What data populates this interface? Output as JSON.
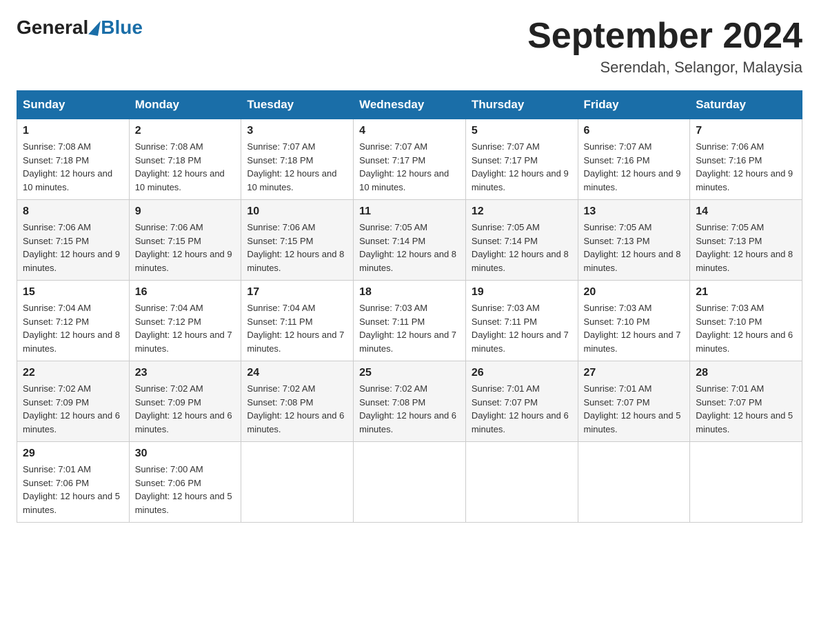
{
  "header": {
    "logo_general": "General",
    "logo_blue": "Blue",
    "month_title": "September 2024",
    "location": "Serendah, Selangor, Malaysia"
  },
  "weekdays": [
    "Sunday",
    "Monday",
    "Tuesday",
    "Wednesday",
    "Thursday",
    "Friday",
    "Saturday"
  ],
  "weeks": [
    [
      {
        "day": "1",
        "sunrise": "7:08 AM",
        "sunset": "7:18 PM",
        "daylight": "12 hours and 10 minutes."
      },
      {
        "day": "2",
        "sunrise": "7:08 AM",
        "sunset": "7:18 PM",
        "daylight": "12 hours and 10 minutes."
      },
      {
        "day": "3",
        "sunrise": "7:07 AM",
        "sunset": "7:18 PM",
        "daylight": "12 hours and 10 minutes."
      },
      {
        "day": "4",
        "sunrise": "7:07 AM",
        "sunset": "7:17 PM",
        "daylight": "12 hours and 10 minutes."
      },
      {
        "day": "5",
        "sunrise": "7:07 AM",
        "sunset": "7:17 PM",
        "daylight": "12 hours and 9 minutes."
      },
      {
        "day": "6",
        "sunrise": "7:07 AM",
        "sunset": "7:16 PM",
        "daylight": "12 hours and 9 minutes."
      },
      {
        "day": "7",
        "sunrise": "7:06 AM",
        "sunset": "7:16 PM",
        "daylight": "12 hours and 9 minutes."
      }
    ],
    [
      {
        "day": "8",
        "sunrise": "7:06 AM",
        "sunset": "7:15 PM",
        "daylight": "12 hours and 9 minutes."
      },
      {
        "day": "9",
        "sunrise": "7:06 AM",
        "sunset": "7:15 PM",
        "daylight": "12 hours and 9 minutes."
      },
      {
        "day": "10",
        "sunrise": "7:06 AM",
        "sunset": "7:15 PM",
        "daylight": "12 hours and 8 minutes."
      },
      {
        "day": "11",
        "sunrise": "7:05 AM",
        "sunset": "7:14 PM",
        "daylight": "12 hours and 8 minutes."
      },
      {
        "day": "12",
        "sunrise": "7:05 AM",
        "sunset": "7:14 PM",
        "daylight": "12 hours and 8 minutes."
      },
      {
        "day": "13",
        "sunrise": "7:05 AM",
        "sunset": "7:13 PM",
        "daylight": "12 hours and 8 minutes."
      },
      {
        "day": "14",
        "sunrise": "7:05 AM",
        "sunset": "7:13 PM",
        "daylight": "12 hours and 8 minutes."
      }
    ],
    [
      {
        "day": "15",
        "sunrise": "7:04 AM",
        "sunset": "7:12 PM",
        "daylight": "12 hours and 8 minutes."
      },
      {
        "day": "16",
        "sunrise": "7:04 AM",
        "sunset": "7:12 PM",
        "daylight": "12 hours and 7 minutes."
      },
      {
        "day": "17",
        "sunrise": "7:04 AM",
        "sunset": "7:11 PM",
        "daylight": "12 hours and 7 minutes."
      },
      {
        "day": "18",
        "sunrise": "7:03 AM",
        "sunset": "7:11 PM",
        "daylight": "12 hours and 7 minutes."
      },
      {
        "day": "19",
        "sunrise": "7:03 AM",
        "sunset": "7:11 PM",
        "daylight": "12 hours and 7 minutes."
      },
      {
        "day": "20",
        "sunrise": "7:03 AM",
        "sunset": "7:10 PM",
        "daylight": "12 hours and 7 minutes."
      },
      {
        "day": "21",
        "sunrise": "7:03 AM",
        "sunset": "7:10 PM",
        "daylight": "12 hours and 6 minutes."
      }
    ],
    [
      {
        "day": "22",
        "sunrise": "7:02 AM",
        "sunset": "7:09 PM",
        "daylight": "12 hours and 6 minutes."
      },
      {
        "day": "23",
        "sunrise": "7:02 AM",
        "sunset": "7:09 PM",
        "daylight": "12 hours and 6 minutes."
      },
      {
        "day": "24",
        "sunrise": "7:02 AM",
        "sunset": "7:08 PM",
        "daylight": "12 hours and 6 minutes."
      },
      {
        "day": "25",
        "sunrise": "7:02 AM",
        "sunset": "7:08 PM",
        "daylight": "12 hours and 6 minutes."
      },
      {
        "day": "26",
        "sunrise": "7:01 AM",
        "sunset": "7:07 PM",
        "daylight": "12 hours and 6 minutes."
      },
      {
        "day": "27",
        "sunrise": "7:01 AM",
        "sunset": "7:07 PM",
        "daylight": "12 hours and 5 minutes."
      },
      {
        "day": "28",
        "sunrise": "7:01 AM",
        "sunset": "7:07 PM",
        "daylight": "12 hours and 5 minutes."
      }
    ],
    [
      {
        "day": "29",
        "sunrise": "7:01 AM",
        "sunset": "7:06 PM",
        "daylight": "12 hours and 5 minutes."
      },
      {
        "day": "30",
        "sunrise": "7:00 AM",
        "sunset": "7:06 PM",
        "daylight": "12 hours and 5 minutes."
      },
      null,
      null,
      null,
      null,
      null
    ]
  ]
}
